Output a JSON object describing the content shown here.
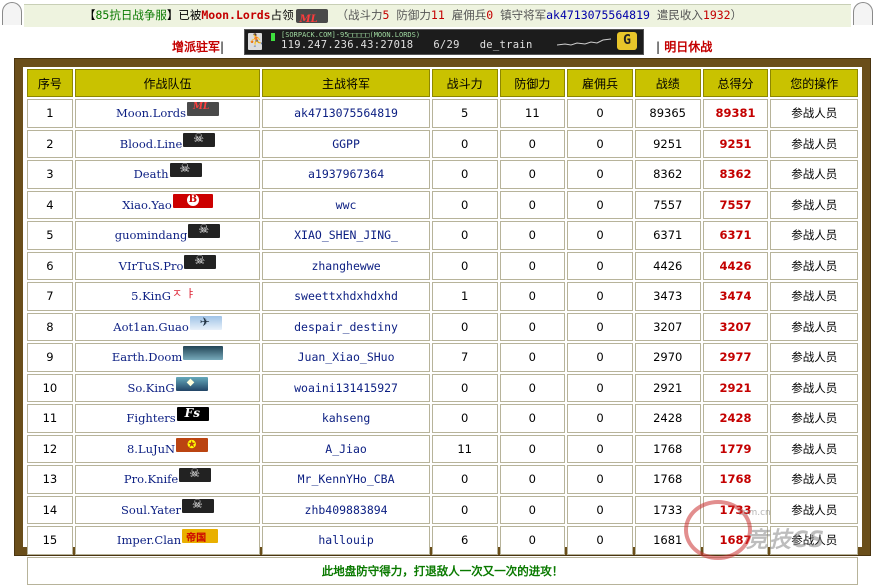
{
  "banner": {
    "bracket_open": "【",
    "server_name": "85抗日战争服",
    "bracket_close": "】",
    "occupied_prefix": "已被",
    "occupier": "Moon.Lords",
    "occupied_suffix": "占领",
    "paren_open": "（",
    "atk_label": "战斗力",
    "atk_value": "5",
    "def_label": "防御力",
    "def_value": "11",
    "merc_label": "雇佣兵",
    "merc_value": "0",
    "general_label": "镇守将军",
    "general_name": "ak4713075564819",
    "tax_label": "遣民收入",
    "tax_value": "1932",
    "paren_close": "）"
  },
  "toolbar": {
    "dispatch_label": "增派驻军",
    "separator_left": "|",
    "separator_right": "|",
    "truce_label": "明日休战"
  },
  "server": {
    "name_line": "[SORPACK.COM]-95□□□□□(MOON.LORDS)",
    "address": "119.247.236.43:27018",
    "players": "6/29",
    "map": "de_train",
    "logo_glyph": "G"
  },
  "table": {
    "headers": [
      "序号",
      "作战队伍",
      "主战将军",
      "战斗力",
      "防御力",
      "雇佣兵",
      "战绩",
      "总得分",
      "您的操作"
    ],
    "rows": [
      {
        "no": "1",
        "team": "Moon.Lords",
        "flag": "ml",
        "general": "ak4713075564819",
        "atk": "5",
        "def": "11",
        "merc": "0",
        "record": "89365",
        "total": "89381",
        "action": "参战人员"
      },
      {
        "no": "2",
        "team": "Blood.Line",
        "flag": "pirate",
        "general": "GGPP",
        "atk": "0",
        "def": "0",
        "merc": "0",
        "record": "9251",
        "total": "9251",
        "action": "参战人员"
      },
      {
        "no": "3",
        "team": "Death",
        "flag": "pirate",
        "general": "a1937967364",
        "atk": "0",
        "def": "0",
        "merc": "0",
        "record": "8362",
        "total": "8362",
        "action": "参战人员"
      },
      {
        "no": "4",
        "team": "Xiao.Yao",
        "flag": "b",
        "general": "wwc",
        "atk": "0",
        "def": "0",
        "merc": "0",
        "record": "7557",
        "total": "7557",
        "action": "参战人员"
      },
      {
        "no": "5",
        "team": "guomindang",
        "flag": "pirate",
        "general": "XIAO_SHEN_JING_",
        "atk": "0",
        "def": "0",
        "merc": "0",
        "record": "6371",
        "total": "6371",
        "action": "参战人员"
      },
      {
        "no": "6",
        "team": "VIrTuS.Pro",
        "flag": "pirate",
        "general": "zhanghewwe",
        "atk": "0",
        "def": "0",
        "merc": "0",
        "record": "4426",
        "total": "4426",
        "action": "参战人员"
      },
      {
        "no": "7",
        "team": "5.KinG",
        "flag": "jp",
        "general": "sweettxhdxhdxhd",
        "atk": "1",
        "def": "0",
        "merc": "0",
        "record": "3473",
        "total": "3474",
        "action": "参战人员"
      },
      {
        "no": "8",
        "team": "Aot1an.Guao",
        "flag": "plane",
        "general": "despair_destiny",
        "atk": "0",
        "def": "0",
        "merc": "0",
        "record": "3207",
        "total": "3207",
        "action": "参战人员"
      },
      {
        "no": "9",
        "team": "Earth.Doom",
        "flag": "earth",
        "general": "Juan_Xiao_SHuo",
        "atk": "7",
        "def": "0",
        "merc": "0",
        "record": "2970",
        "total": "2977",
        "action": "参战人员"
      },
      {
        "no": "10",
        "team": "So.KinG",
        "flag": "soking",
        "general": "woaini131415927",
        "atk": "0",
        "def": "0",
        "merc": "0",
        "record": "2921",
        "total": "2921",
        "action": "参战人员"
      },
      {
        "no": "11",
        "team": "Fighters",
        "flag": "fs",
        "general": "kahseng",
        "atk": "0",
        "def": "0",
        "merc": "0",
        "record": "2428",
        "total": "2428",
        "action": "参战人员"
      },
      {
        "no": "12",
        "team": "8.LuJuN",
        "flag": "ju",
        "general": "A_Jiao",
        "atk": "11",
        "def": "0",
        "merc": "0",
        "record": "1768",
        "total": "1779",
        "action": "参战人员"
      },
      {
        "no": "13",
        "team": "Pro.Knife",
        "flag": "pirate",
        "general": "Mr_KennYHo_CBA",
        "atk": "0",
        "def": "0",
        "merc": "0",
        "record": "1768",
        "total": "1768",
        "action": "参战人员"
      },
      {
        "no": "14",
        "team": "Soul.Yater",
        "flag": "pirate",
        "general": "zhb409883894",
        "atk": "0",
        "def": "0",
        "merc": "0",
        "record": "1733",
        "total": "1733",
        "action": "参战人员"
      },
      {
        "no": "15",
        "team": "Imper.Clan",
        "flag": "empire",
        "general": "hallouip",
        "atk": "6",
        "def": "0",
        "merc": "0",
        "record": "1681",
        "total": "1687",
        "action": "参战人员"
      }
    ],
    "footer": "此地盘防守得力，打退敌人一次又一次的进攻！"
  },
  "colors": {
    "header_bg": "#c9c200",
    "frame": "#6a4e1a",
    "accent_red": "#c40000",
    "link_blue": "#0b1e82",
    "footer_green": "#0a7a00"
  },
  "icons": [
    "ml-team-logo-icon",
    "pirate-flag-icon",
    "player-icon",
    "gametracker-logo-icon"
  ],
  "watermark": {
    "text": "竞技CS",
    "small": "com.cn"
  }
}
